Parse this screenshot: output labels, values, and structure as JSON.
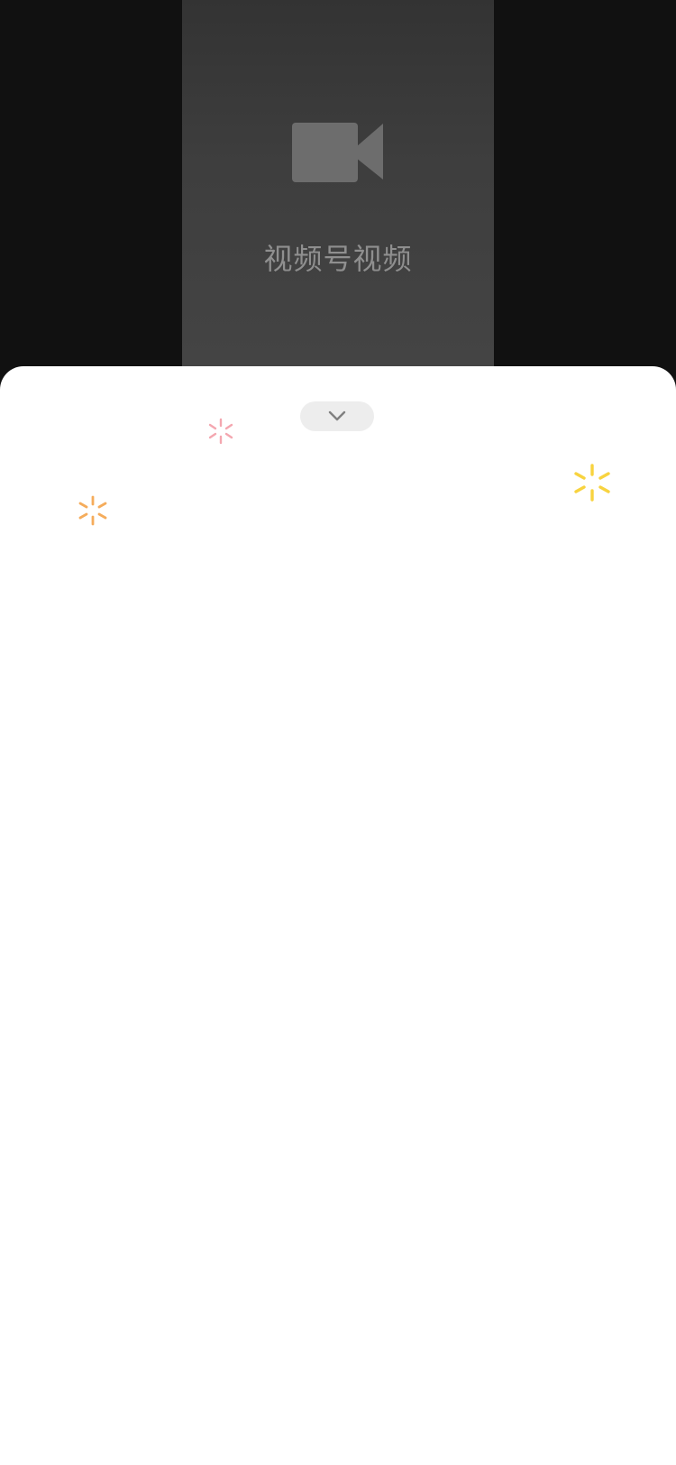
{
  "video": {
    "label": "视频号视频",
    "icon": "video-camera-icon",
    "icon_color": "#6d6d6d"
  },
  "sheet": {
    "collapse_icon": "chevron-down-icon",
    "handle_color": "#ededed"
  },
  "decorations": {
    "sparkles": [
      {
        "icon": "sparkle-icon",
        "color": "#f4a7b0"
      },
      {
        "icon": "sparkle-icon",
        "color": "#f5ac5b"
      },
      {
        "icon": "sparkle-icon",
        "color": "#f8d33f"
      }
    ]
  }
}
